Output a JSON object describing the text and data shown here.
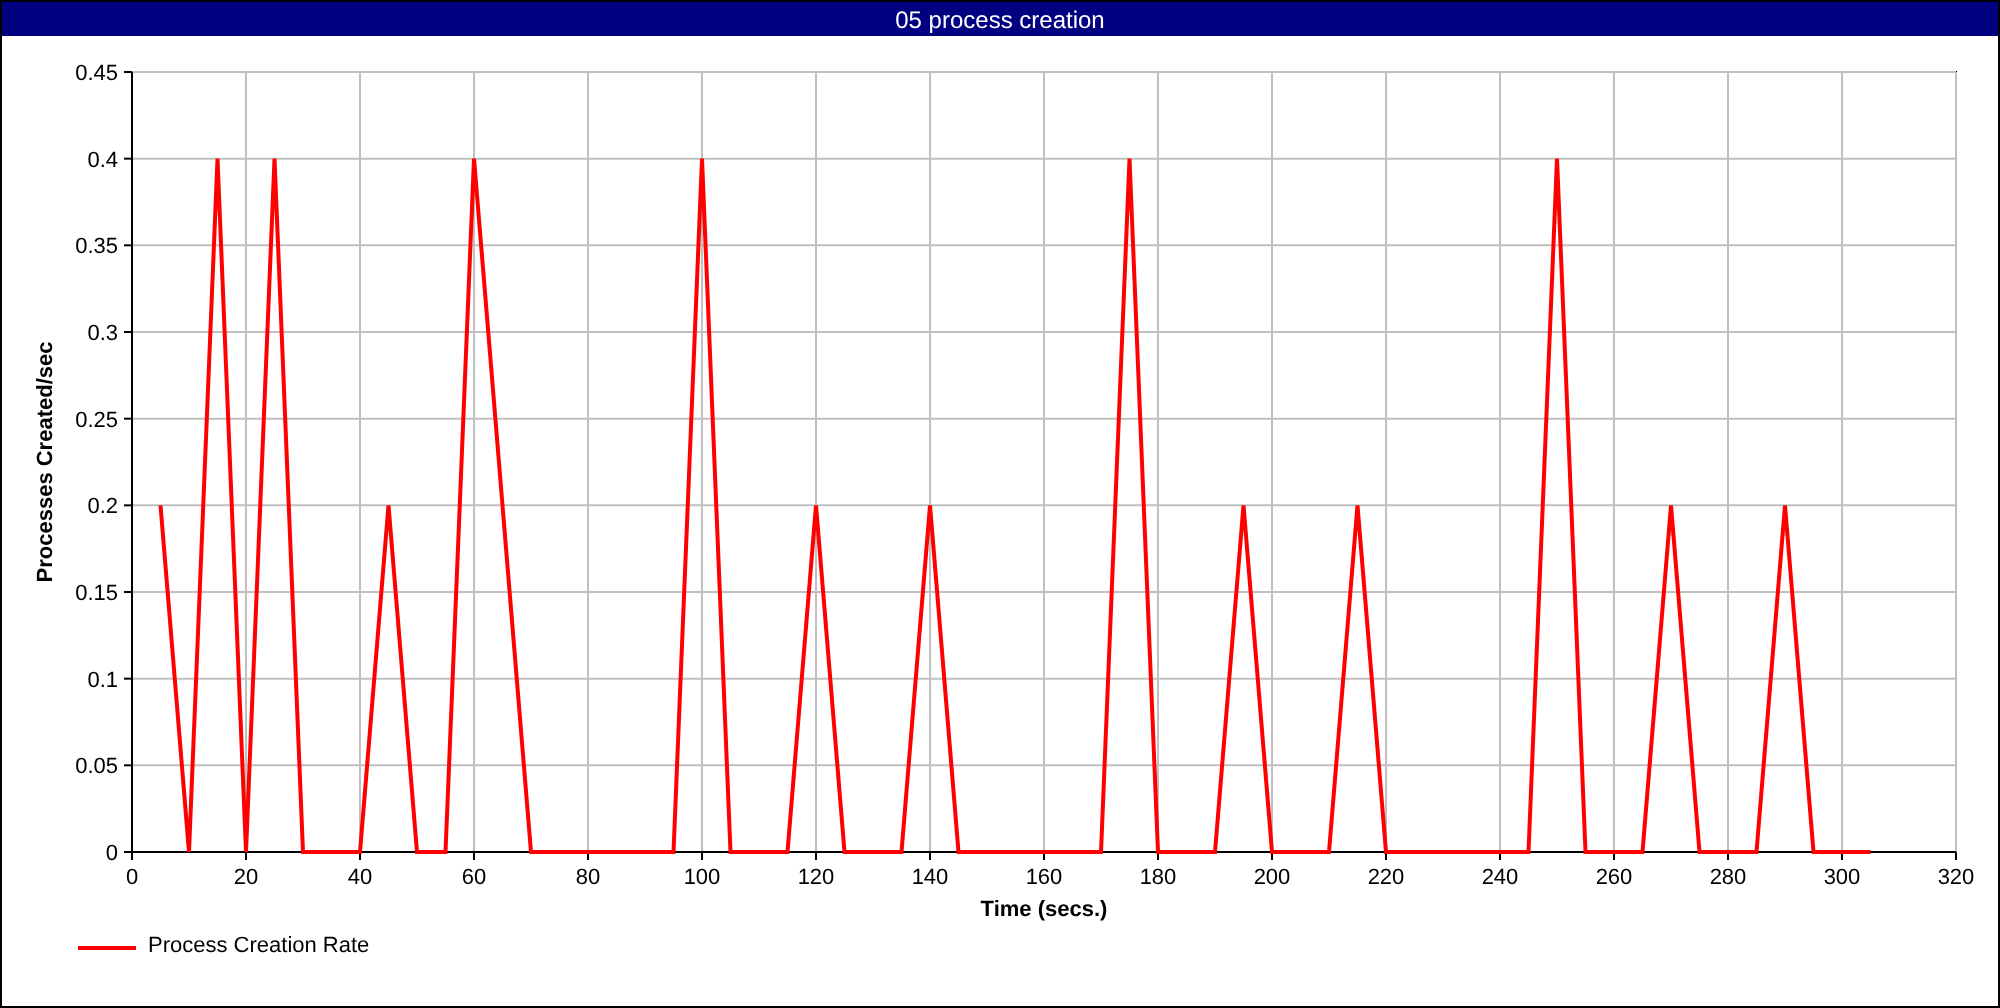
{
  "window": {
    "title": "05 process creation"
  },
  "chart": {
    "chart_data": {
      "type": "line",
      "xlabel": "Time (secs.)",
      "ylabel": "Processes Created/sec",
      "x": [
        5,
        10,
        15,
        20,
        25,
        30,
        35,
        40,
        45,
        50,
        55,
        60,
        65,
        70,
        75,
        80,
        85,
        90,
        95,
        100,
        105,
        110,
        115,
        120,
        125,
        130,
        135,
        140,
        145,
        150,
        155,
        160,
        165,
        170,
        175,
        180,
        185,
        190,
        195,
        200,
        205,
        210,
        215,
        220,
        225,
        230,
        235,
        240,
        245,
        250,
        255,
        260,
        265,
        270,
        275,
        280,
        285,
        290,
        295,
        300,
        305
      ],
      "series": [
        {
          "name": "Process Creation Rate",
          "color": "#ff0000",
          "values": [
            0.2,
            0,
            0.4,
            0,
            0.4,
            0,
            0,
            0,
            0.2,
            0,
            0,
            0.4,
            0.2,
            0,
            0,
            0,
            0,
            0,
            0,
            0.4,
            0,
            0,
            0,
            0.2,
            0,
            0,
            0,
            0.2,
            0,
            0,
            0,
            0,
            0,
            0,
            0.4,
            0,
            0,
            0,
            0.2,
            0,
            0,
            0,
            0.2,
            0,
            0,
            0,
            0,
            0,
            0,
            0.4,
            0,
            0,
            0,
            0.2,
            0,
            0,
            0,
            0.2,
            0,
            0,
            0
          ]
        }
      ],
      "xlim": [
        0,
        320
      ],
      "ylim": [
        0,
        0.45
      ],
      "xticks": [
        0,
        20,
        40,
        60,
        80,
        100,
        120,
        140,
        160,
        180,
        200,
        220,
        240,
        260,
        280,
        300,
        320
      ],
      "yticks": [
        0,
        0.05,
        0.1,
        0.15,
        0.2,
        0.25,
        0.3,
        0.35,
        0.4,
        0.45
      ],
      "grid": true
    }
  }
}
